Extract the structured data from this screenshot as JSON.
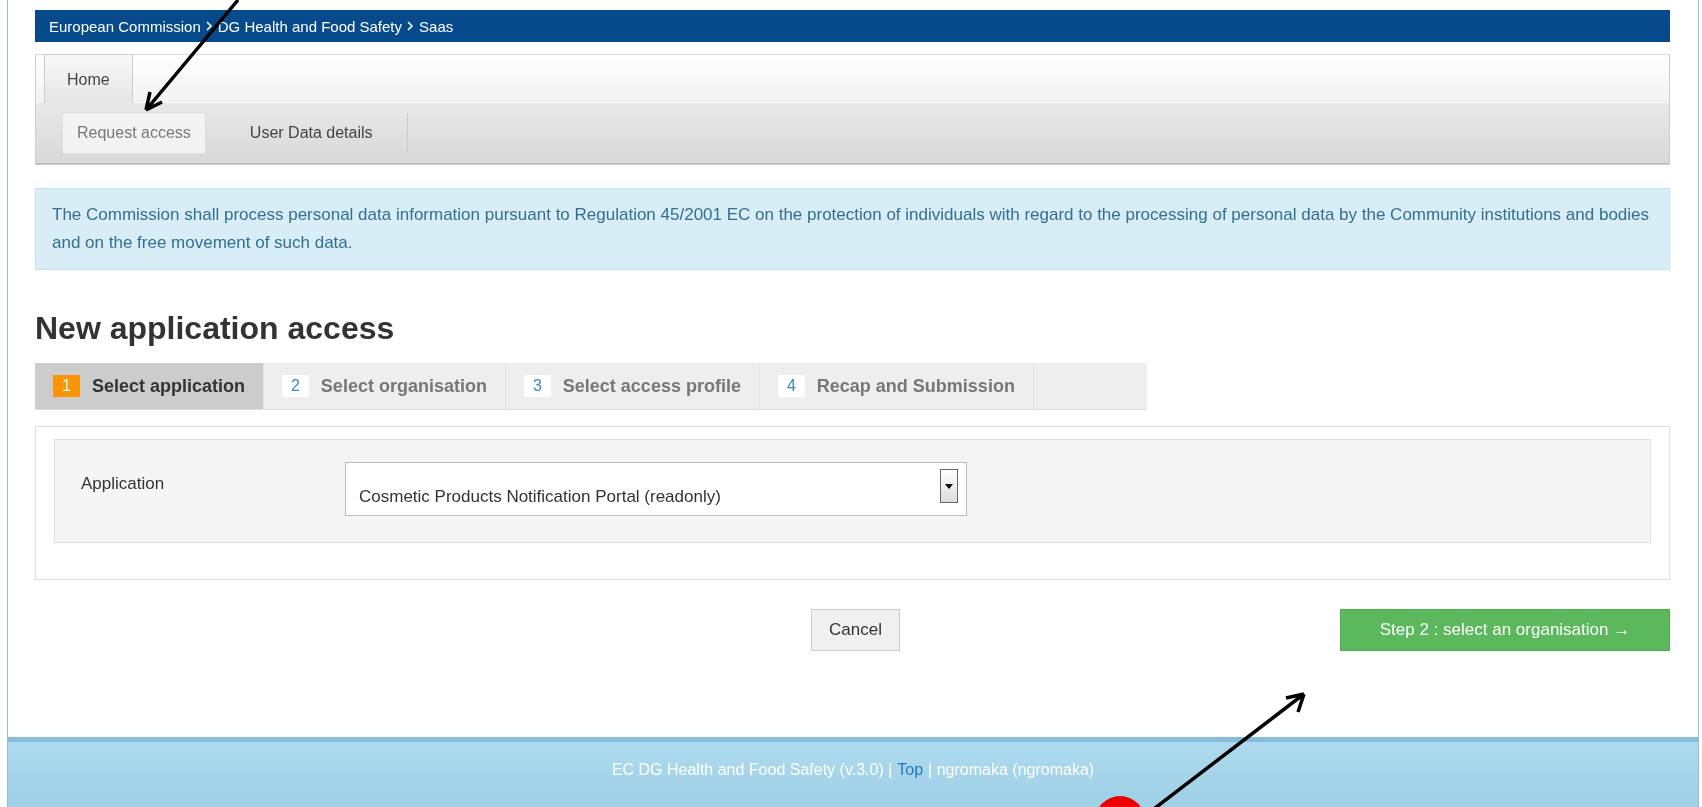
{
  "breadcrumb": [
    "European Commission",
    "DG Health and Food Safety",
    "Saas"
  ],
  "tabs": [
    {
      "label": "Home",
      "selected": true
    }
  ],
  "subnav": [
    {
      "label": "Request access",
      "selected": true
    },
    {
      "label": "User Data details",
      "selected": false
    }
  ],
  "notice": "The Commission shall process personal data information pursuant to Regulation 45/2001 EC on the protection of individuals with regard to the processing of personal data by the Community institutions and bodies and on the free movement of such data.",
  "heading": "New application access",
  "steps": [
    {
      "number": "1",
      "label": "Select application",
      "selected": true
    },
    {
      "number": "2",
      "label": "Select organisation",
      "selected": false
    },
    {
      "number": "3",
      "label": "Select access profile",
      "selected": false
    },
    {
      "number": "4",
      "label": "Recap and Submission",
      "selected": false
    }
  ],
  "form": {
    "label": "Application",
    "value": "Cosmetic Products Notification Portal (readonly)"
  },
  "buttons": {
    "cancel": "Cancel",
    "next": "Step 2 : select an organisation →"
  },
  "footer": {
    "text": "EC DG Health and Food Safety (v.3.0) |",
    "link": "Top",
    "user": "| ngromaka (ngromaka)"
  }
}
